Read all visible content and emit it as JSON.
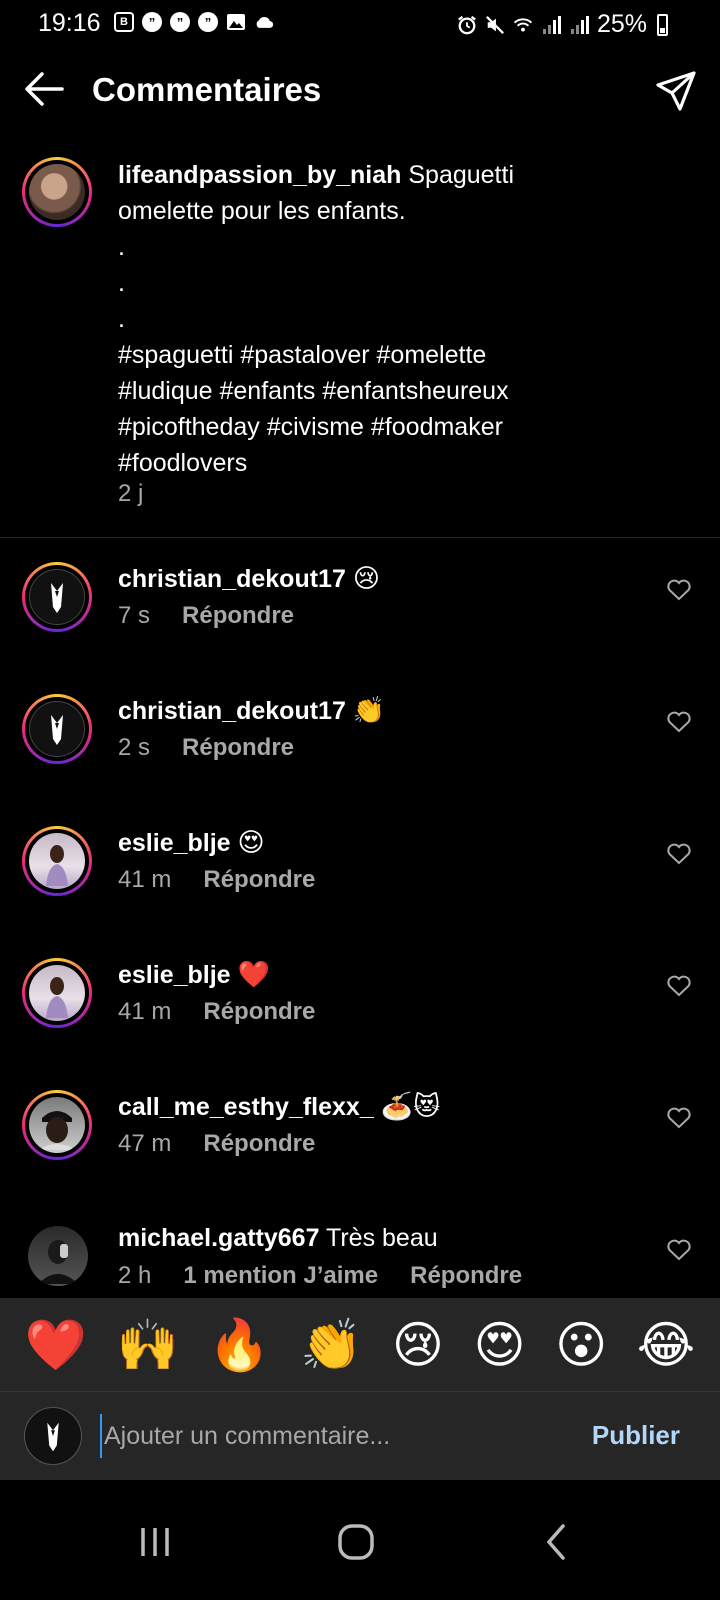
{
  "status_bar": {
    "time": "19:16",
    "battery": "25%",
    "left_icons": [
      "b-icon",
      "quote-icon",
      "quote-icon",
      "quote-icon",
      "image-icon",
      "cloud-icon"
    ],
    "right_icons": [
      "alarm-icon",
      "mute-icon",
      "wifi-icon",
      "signal-icon",
      "signal-icon"
    ]
  },
  "header": {
    "title": "Commentaires"
  },
  "caption": {
    "username": "lifeandpassion_by_niah",
    "lines": [
      " Spaguetti",
      "omelette pour les enfants.",
      ".",
      ".",
      ".",
      "#spaguetti #pastalover #omelette",
      "#ludique #enfants #enfantsheureux",
      "#picoftheday #civisme #foodmaker",
      "#foodlovers"
    ],
    "time": "2 j"
  },
  "comments": [
    {
      "username": "christian_dekout17",
      "text": "",
      "emoji": "😢",
      "time": "7 s",
      "reply": "Répondre"
    },
    {
      "username": "christian_dekout17",
      "text": "",
      "emoji": "👏",
      "time": "2 s",
      "reply": "Répondre"
    },
    {
      "username": "eslie_blje",
      "text": "",
      "emoji": "😍",
      "time": "41 m",
      "reply": "Répondre"
    },
    {
      "username": "eslie_blje",
      "text": "",
      "emoji": "❤️",
      "time": "41 m",
      "reply": "Répondre"
    },
    {
      "username": "call_me_esthy_flexx_",
      "text": "",
      "emoji": "🍝😻",
      "time": "47 m",
      "reply": "Répondre"
    },
    {
      "username": "michael.gatty667",
      "text": " Très beau",
      "emoji": "",
      "time": "2 h",
      "likes": "1 mention J’aime",
      "reply": "Répondre"
    }
  ],
  "emoji_bar": [
    "❤️",
    "🙌",
    "🔥",
    "👏",
    "😢",
    "😍",
    "😮",
    "😂"
  ],
  "input": {
    "placeholder": "Ajouter un commentaire...",
    "publish": "Publier"
  },
  "colors": {
    "background": "#000000",
    "bar": "#262626",
    "secondary_text": "#a8a8a8",
    "publish": "#b3d6f9"
  }
}
